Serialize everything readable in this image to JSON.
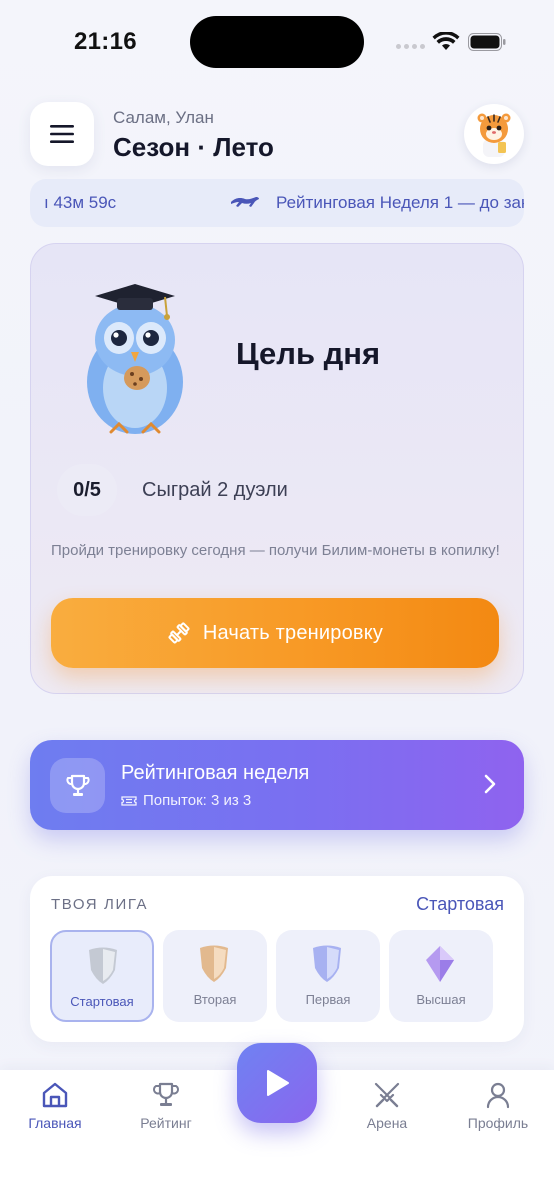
{
  "status_bar": {
    "time": "21:16"
  },
  "header": {
    "greeting": "Салам, Улан",
    "season_title": "Сезон · Лето"
  },
  "ticker": {
    "timer": "ı 43м 59с",
    "message": "Рейтинговая Неделя 1 — до закр"
  },
  "goal": {
    "title": "Цель дня",
    "counter": "0/5",
    "task": "Сыграй 2 дуэли",
    "note": "Пройди тренировку сегодня — получи Билим-монеты в копилку!",
    "button_label": "Начать тренировку"
  },
  "rating_week": {
    "title": "Рейтинговая неделя",
    "attempts": "Попыток: 3 из 3"
  },
  "league": {
    "label": "ТВОЯ ЛИГА",
    "current": "Стартовая",
    "tiers": [
      {
        "label": "Стартовая",
        "color": "#b8bec9"
      },
      {
        "label": "Вторая",
        "color": "#e3b98e"
      },
      {
        "label": "Первая",
        "color": "#a9b2f2"
      },
      {
        "label": "Высшая",
        "color": "#b79af0"
      }
    ]
  },
  "bottom_nav": {
    "items": [
      {
        "label": "Главная",
        "icon": "home-icon"
      },
      {
        "label": "Рейтинг",
        "icon": "trophy-icon"
      },
      {
        "label": "Арена",
        "icon": "swords-icon"
      },
      {
        "label": "Профиль",
        "icon": "profile-icon"
      }
    ],
    "center_icon": "play-icon"
  },
  "colors": {
    "accent": "#4a56b8",
    "orange": "#f89a26",
    "purple": "#7a6ff1"
  }
}
